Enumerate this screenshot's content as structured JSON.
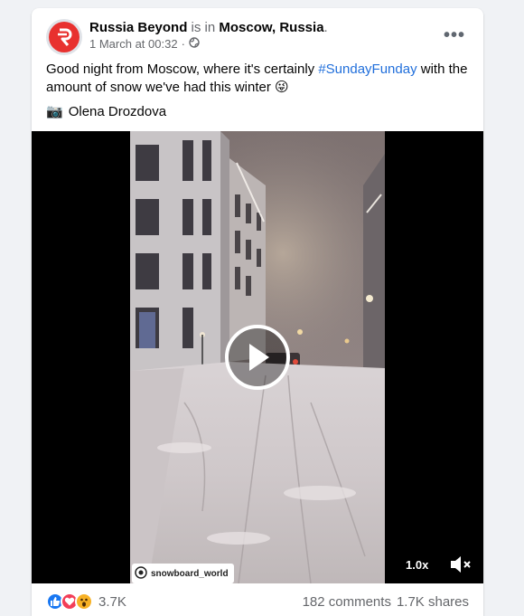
{
  "post": {
    "author": "Russia Beyond",
    "is_in": " is in ",
    "location": "Moscow, Russia",
    "period": ".",
    "date": "1 March at 00:32",
    "separator": "·",
    "privacy_icon": "globe-icon",
    "text_before": "Good night from Moscow, where it's certainly ",
    "hashtag": "#SundayFunday",
    "text_after": " with the amount of snow we've had this winter ",
    "emoji": "😜",
    "credit_icon": "📷",
    "credit": "Olena Drozdova",
    "more_icon": "•••"
  },
  "video": {
    "watermark": "snowboard_world",
    "speed": "1.0x",
    "play_icon": "play-icon",
    "mute_icon": "mute-icon"
  },
  "footer": {
    "reaction_icons": [
      "like-icon",
      "love-icon",
      "wow-icon"
    ],
    "reaction_count": "3.7K",
    "comments": "182 comments",
    "shares": "1.7K shares"
  },
  "colors": {
    "brand_red": "#e8312f",
    "link_blue": "#216fdb",
    "like_blue": "#1877f2",
    "love_red": "#f33e58",
    "wow_yellow": "#f7b125",
    "muted_text": "#65676b"
  }
}
